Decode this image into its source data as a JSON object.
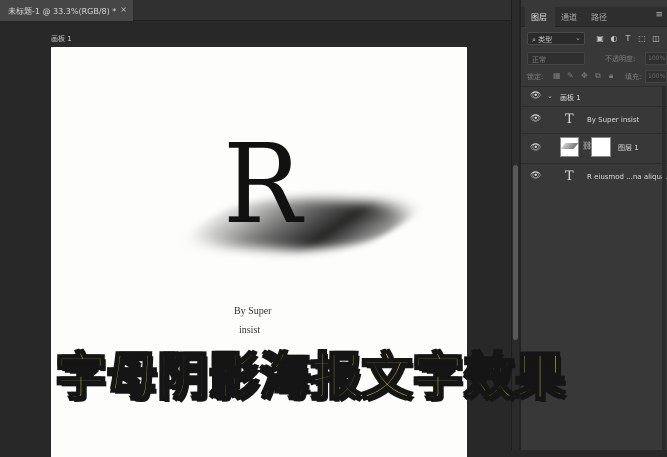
{
  "document_tab": {
    "title": "未标题-1 @ 33.3%(RGB/8) *",
    "close_glyph": "×"
  },
  "canvas": {
    "artboard_label": "画板 1",
    "big_letter": "R",
    "by_line_1": "By Super",
    "by_line_2": "insist"
  },
  "panel": {
    "tabs": [
      "图层",
      "通道",
      "路径"
    ],
    "menu_glyph": "≡",
    "filter": {
      "value": "类型",
      "icons": [
        "image-filter-icon",
        "adjust-filter-icon",
        "type-filter-icon",
        "shape-filter-icon",
        "smart-filter-icon"
      ]
    },
    "blend_mode": "正常",
    "opacity_label": "不透明度:",
    "opacity_value": "100%",
    "lock_label": "锁定:",
    "fill_label": "填充:",
    "fill_value": "100%",
    "layers": [
      {
        "name": "画板 1",
        "type": "group"
      },
      {
        "name": "By Super   insist",
        "type": "text"
      },
      {
        "name": "图层 1",
        "type": "pixel"
      },
      {
        "name": "R   eiusmod ...na aliqua.",
        "type": "text"
      }
    ]
  },
  "caption": "字母阴影海报文字效果",
  "colors": {
    "caption_fill": "#f7f24a",
    "caption_stroke": "#151515",
    "artboard": "#fdfdfb",
    "workspace": "#282828",
    "panel": "#383838"
  }
}
